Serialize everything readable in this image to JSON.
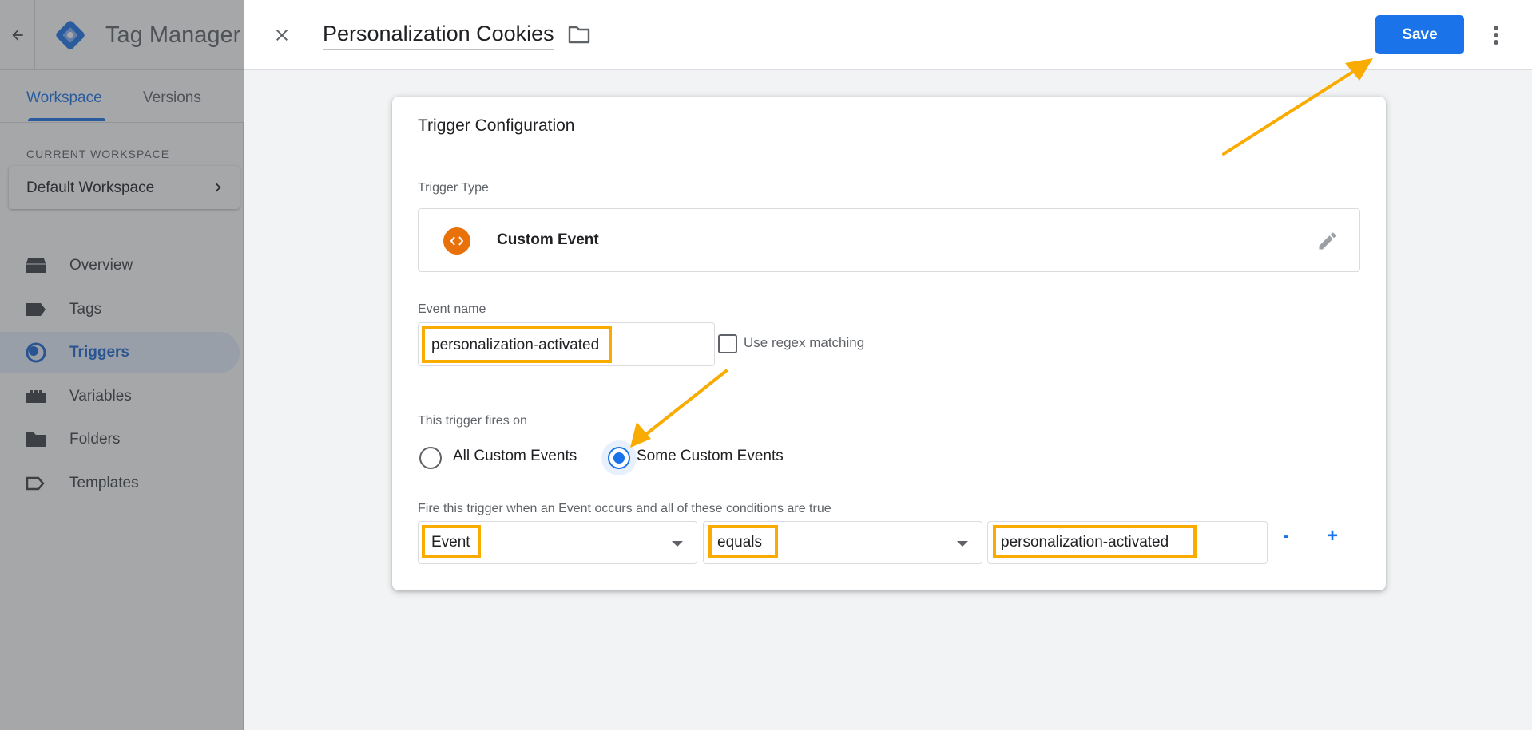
{
  "app": {
    "name": "Tag Manager",
    "tabs": [
      {
        "label": "Workspace",
        "active": true
      },
      {
        "label": "Versions",
        "active": false
      }
    ],
    "current_workspace_label": "CURRENT WORKSPACE",
    "current_workspace_name": "Default Workspace",
    "nav": [
      {
        "label": "Overview",
        "icon": "overview-icon",
        "active": false
      },
      {
        "label": "Tags",
        "icon": "tag-icon",
        "active": false
      },
      {
        "label": "Triggers",
        "icon": "trigger-icon",
        "active": true
      },
      {
        "label": "Variables",
        "icon": "variables-icon",
        "active": false
      },
      {
        "label": "Folders",
        "icon": "folder-icon",
        "active": false
      },
      {
        "label": "Templates",
        "icon": "template-icon",
        "active": false
      }
    ]
  },
  "editor": {
    "title": "Personalization Cookies",
    "save_label": "Save"
  },
  "trigger_config": {
    "heading": "Trigger Configuration",
    "trigger_type_label": "Trigger Type",
    "trigger_type_name": "Custom Event",
    "event_name_label": "Event name",
    "event_name_value": "personalization-activated",
    "regex_label": "Use regex matching",
    "regex_checked": false,
    "fires_on_label": "This trigger fires on",
    "fires_on_options": [
      {
        "label": "All Custom Events",
        "selected": false
      },
      {
        "label": "Some Custom Events",
        "selected": true
      }
    ],
    "condition_label": "Fire this trigger when an Event occurs and all of these conditions are true",
    "condition": {
      "variable": "Event",
      "operator": "equals",
      "value": "personalization-activated"
    },
    "remove_symbol": "-",
    "add_symbol": "+"
  },
  "colors": {
    "accent": "#1a73e8",
    "highlight": "#f9ab00",
    "custom_event_icon": "#e8710a"
  }
}
